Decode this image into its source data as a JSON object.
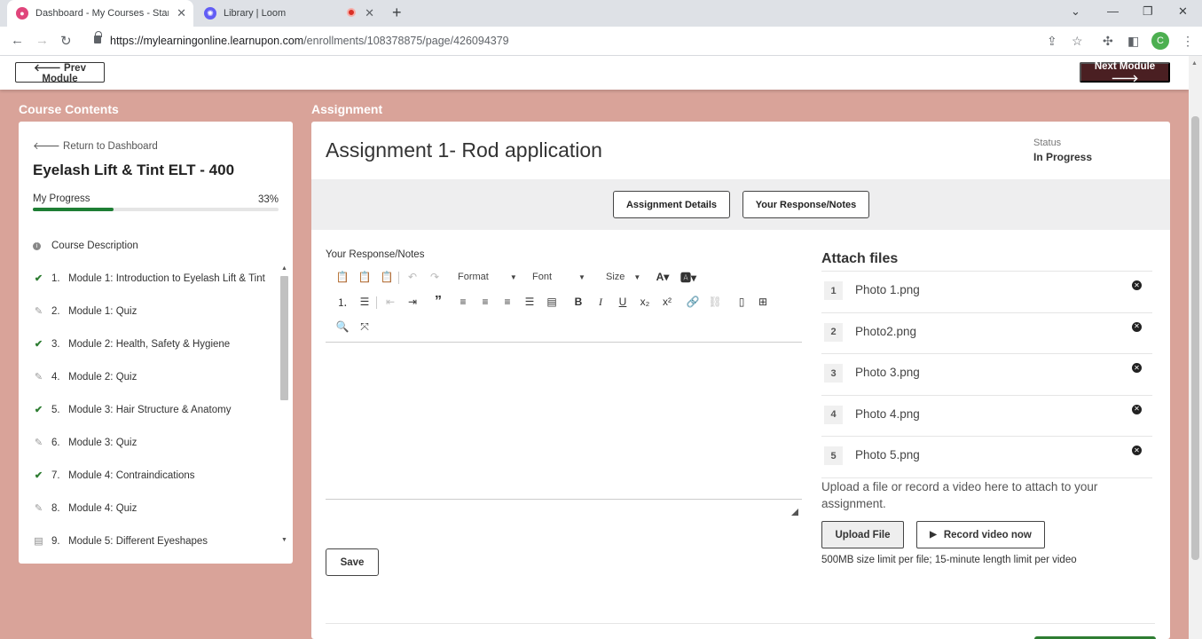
{
  "browser": {
    "tabs": [
      {
        "title": "Dashboard - My Courses - Start C"
      },
      {
        "title": "Library | Loom"
      }
    ],
    "url_host": "https://mylearningonline.learnupon.com",
    "url_path": "/enrollments/108378875/page/426094379",
    "profile_initial": "C",
    "icons": [
      "back-icon",
      "forward-icon",
      "reload-icon",
      "lock-icon",
      "share-icon",
      "star-icon",
      "extensions-icon",
      "sidebar-icon",
      "menu-icon"
    ]
  },
  "nav": {
    "prev": "🡐 Prev Module",
    "next": "Next Module 🡒"
  },
  "sidebar": {
    "heading": "Course Contents",
    "return_label": "Return to Dashboard",
    "course_title": "Eyelash Lift & Tint ELT - 400",
    "progress_label": "My Progress",
    "progress_pct": "33%",
    "progress_value": 0.33,
    "course_description": "Course Description",
    "modules": [
      {
        "num": "1.",
        "label": "Module 1: Introduction to Eyelash Lift & Tint",
        "icon": "check-icon"
      },
      {
        "num": "2.",
        "label": "Module 1: Quiz",
        "icon": "edit-icon"
      },
      {
        "num": "3.",
        "label": "Module 2: Health, Safety & Hygiene",
        "icon": "check-icon"
      },
      {
        "num": "4.",
        "label": "Module 2: Quiz",
        "icon": "edit-icon"
      },
      {
        "num": "5.",
        "label": "Module 3: Hair Structure & Anatomy",
        "icon": "check-icon"
      },
      {
        "num": "6.",
        "label": "Module 3: Quiz",
        "icon": "edit-icon"
      },
      {
        "num": "7.",
        "label": "Module 4: Contraindications",
        "icon": "check-icon"
      },
      {
        "num": "8.",
        "label": "Module 4: Quiz",
        "icon": "edit-icon"
      },
      {
        "num": "9.",
        "label": "Module 5: Different Eyeshapes",
        "icon": "book-icon"
      }
    ]
  },
  "assignment": {
    "heading": "Assignment",
    "title": "Assignment 1- Rod application",
    "status_label": "Status",
    "status_value": "In Progress",
    "tab_details": "Assignment Details",
    "tab_response": "Your Response/Notes",
    "response_label": "Your Response/Notes",
    "toolbar": {
      "format": "Format",
      "font": "Font",
      "size": "Size"
    },
    "save_label": "Save"
  },
  "attachments": {
    "heading": "Attach files",
    "files": [
      {
        "num": "1",
        "name": "Photo 1.png"
      },
      {
        "num": "2",
        "name": "Photo2.png"
      },
      {
        "num": "3",
        "name": "Photo 3.png"
      },
      {
        "num": "4",
        "name": "Photo 4.png"
      },
      {
        "num": "5",
        "name": "Photo 5.png"
      }
    ],
    "upload_note": "Upload a file or record a video here to attach to your assignment.",
    "upload_button": "Upload File",
    "record_button": "Record video now",
    "limit_note": "500MB size limit per file; 15-minute length limit per video"
  },
  "colors": {
    "page_bg": "#d9a399",
    "next_button": "#4a1f22",
    "progress": "#1e7e34",
    "check": "#2e7d32"
  }
}
